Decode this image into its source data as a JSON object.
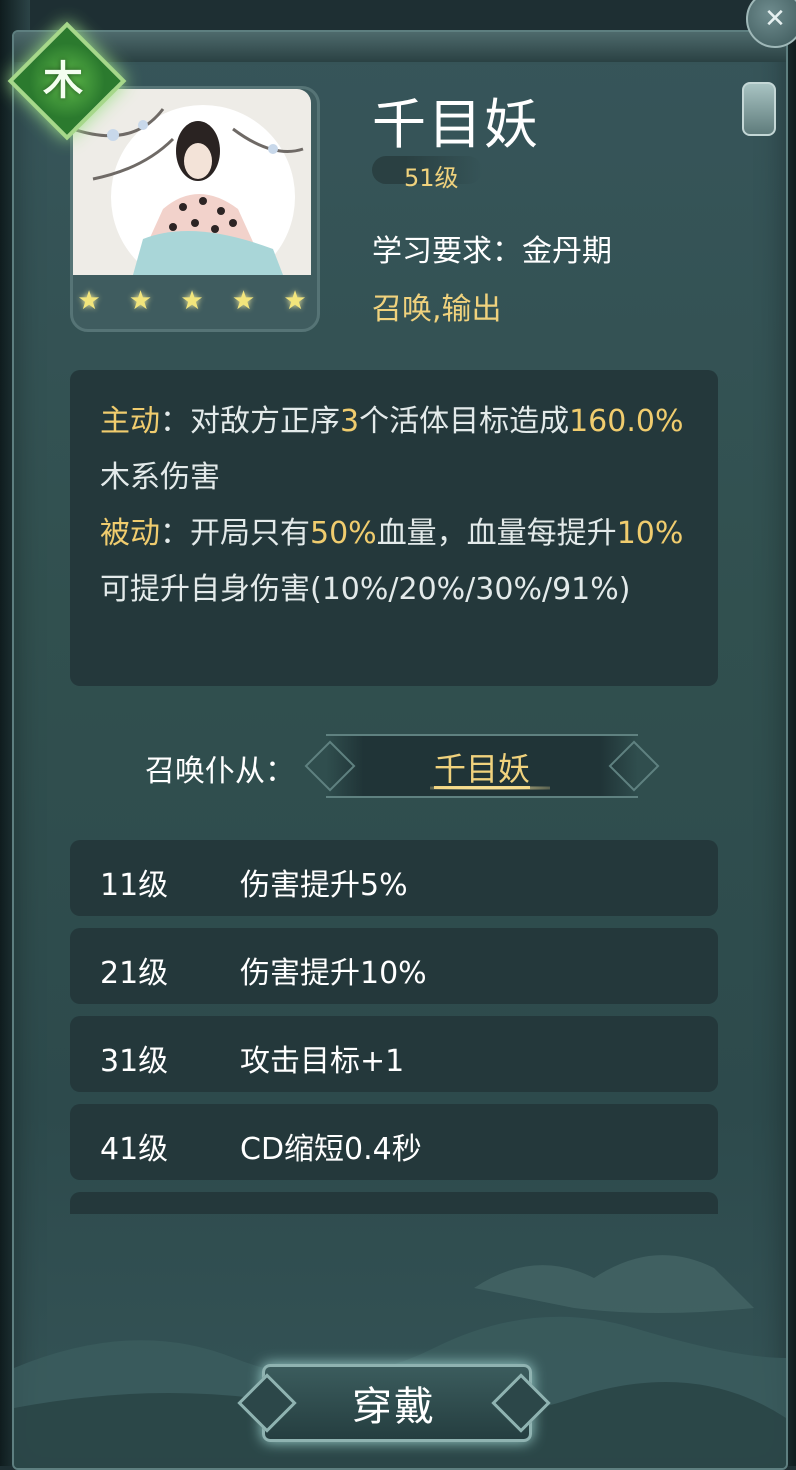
{
  "element_badge": "木",
  "skill": {
    "name": "千目妖",
    "level": "51级",
    "requirement": "学习要求：金丹期",
    "tags": "召唤,输出",
    "stars": 5
  },
  "description": {
    "active_label": "主动",
    "active_p1": "：对敌方正序",
    "active_n1": "3",
    "active_p2": "个活体目标造成",
    "active_n2": "160.0%",
    "active_p3": "木系伤害",
    "passive_label": "被动",
    "passive_p1": "：开局只有",
    "passive_n1": "50%",
    "passive_p2": "血量，血量每提升",
    "passive_n2": "10%",
    "passive_p3": "可提升自身伤害(10%/20%/30%/91%)"
  },
  "summon": {
    "label": "召唤仆从：",
    "name": "千目妖"
  },
  "upgrades": [
    {
      "level": "11级",
      "effect": "伤害提升5%"
    },
    {
      "level": "21级",
      "effect": "伤害提升10%"
    },
    {
      "level": "31级",
      "effect": "攻击目标+1"
    },
    {
      "level": "41级",
      "effect": "CD缩短0.4秒"
    }
  ],
  "equip_button": "穿戴",
  "icons": {
    "close": "close-icon",
    "star": "star-icon",
    "element": "wood-element-icon"
  },
  "colors": {
    "accent_gold": "#f0cc6e",
    "panel": "#31504f",
    "box": "#24383b"
  }
}
